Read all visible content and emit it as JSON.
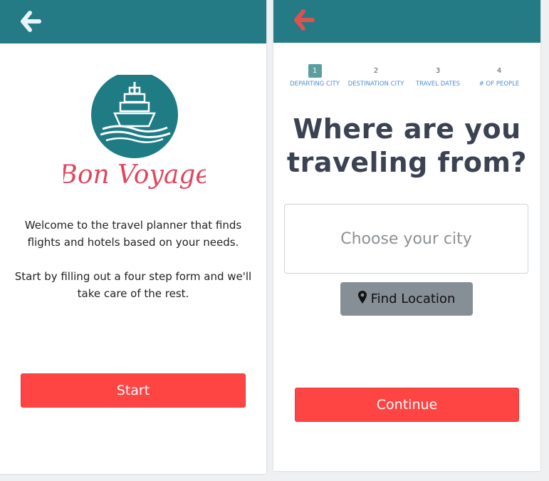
{
  "left_screen": {
    "logo_text": "Bon Voyage",
    "welcome_line_1": "Welcome to the travel planner that finds flights and hotels based on your needs.",
    "welcome_line_2": "Start by filling out a four step form and we'll take care of the rest.",
    "start_label": "Start"
  },
  "right_screen": {
    "steps": [
      {
        "number": "1",
        "label": "DEPARTING CITY"
      },
      {
        "number": "2",
        "label": "DESTINATION CITY"
      },
      {
        "number": "3",
        "label": "TRAVEL DATES"
      },
      {
        "number": "4",
        "label": "# OF PEOPLE"
      }
    ],
    "active_step": 1,
    "question": "Where are you traveling from?",
    "city_placeholder": "Choose your city",
    "find_location_label": "Find Location",
    "continue_label": "Continue"
  },
  "colors": {
    "header": "#247a85",
    "accent": "#ff4444",
    "back_arrow_left": "#e8f4ff",
    "back_arrow_right": "#d9534f"
  },
  "icons": [
    "back-arrow-icon",
    "ship-logo-icon",
    "map-marker-icon"
  ]
}
